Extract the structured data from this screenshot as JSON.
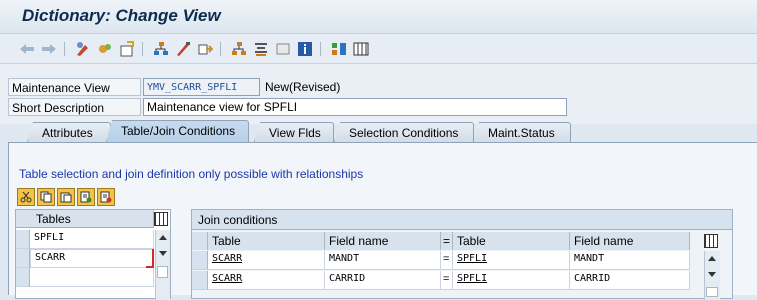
{
  "window": {
    "title": "Dictionary: Change View"
  },
  "toolbar": {
    "icons": [
      "back-arrow-icon",
      "forward-arrow-icon",
      "display-change-icon",
      "other-object-icon",
      "activate-icon",
      "check-icon",
      "test-icon",
      "where-used-icon",
      "object-list-icon",
      "hierarchy-icon",
      "info-icon",
      "table-icon",
      "graphic-icon"
    ]
  },
  "form": {
    "maintenance_view_label": "Maintenance View",
    "maintenance_view_value": "YMV_SCARR_SPFLI",
    "status_text": "New(Revised)",
    "short_description_label": "Short Description",
    "short_description_value": "Maintenance view for SPFLI"
  },
  "tabs": [
    {
      "label": "Attributes",
      "active": false
    },
    {
      "label": "Table/Join Conditions",
      "active": true
    },
    {
      "label": "View Flds",
      "active": false
    },
    {
      "label": "Selection Conditions",
      "active": false
    },
    {
      "label": "Maint.Status",
      "active": false
    }
  ],
  "content": {
    "hint": "Table selection and join definition only possible with relationships",
    "tables": {
      "header": "Tables",
      "rows": [
        "SPFLI",
        "SCARR",
        ""
      ]
    },
    "join": {
      "title": "Join conditions",
      "columns": [
        "Table",
        "Field name",
        "=",
        "Table",
        "Field name"
      ],
      "rows": [
        {
          "table1": "SCARR",
          "field1": "MANDT",
          "eq": "=",
          "table2": "SPFLI",
          "field2": "MANDT"
        },
        {
          "table1": "SCARR",
          "field1": "CARRID",
          "eq": "=",
          "table2": "SPFLI",
          "field2": "CARRID"
        }
      ]
    }
  },
  "colors": {
    "accent": "#1d36a8",
    "title": "#0d2b4d",
    "tab_active": "#c6dbef"
  }
}
